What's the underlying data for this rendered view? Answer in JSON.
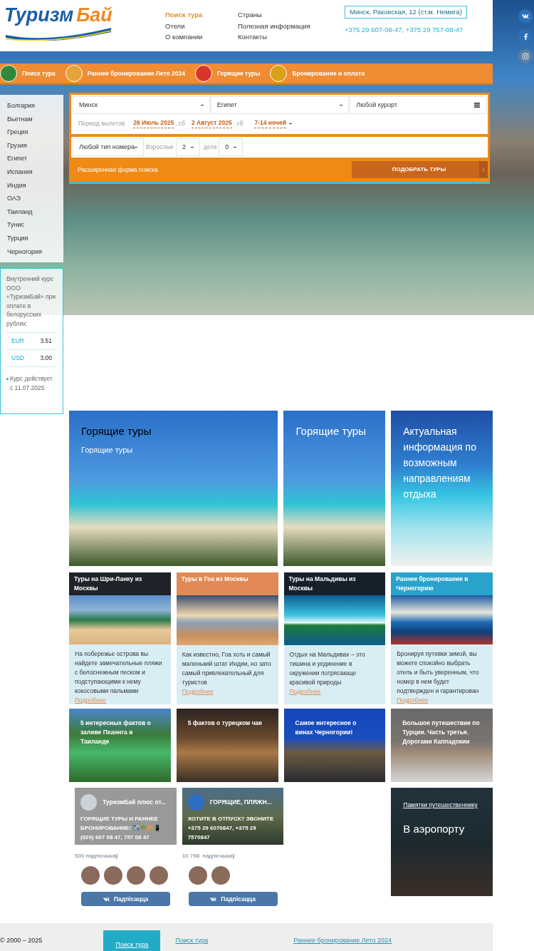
{
  "header": {
    "logo": {
      "first": "Туризм",
      "second": "Бай"
    },
    "nav_columns": [
      [
        {
          "label": "Поиск тура",
          "selected": true
        },
        {
          "label": "Отели",
          "selected": false
        },
        {
          "label": "О компании",
          "selected": false
        }
      ],
      [
        {
          "label": "Страны",
          "selected": false
        },
        {
          "label": "Полезная информация",
          "selected": false
        },
        {
          "label": "Контакты",
          "selected": false
        }
      ]
    ],
    "address": "Минск, Раковская, 12 (ст.м. Немига)",
    "phones": "+375 29 607-08-47, +375 29 757-08-47"
  },
  "social": [
    {
      "kind": "vk"
    },
    {
      "kind": "facebook"
    },
    {
      "kind": "instagram"
    }
  ],
  "nav_bar": [
    {
      "label": "Поиск тура",
      "color": "#2f8a3c"
    },
    {
      "label": "Раннее бронирование Лето 2024",
      "color": "#e7a23a"
    },
    {
      "label": "Горящие туры",
      "color": "#d8362a"
    },
    {
      "label": "Бронирование и оплата",
      "color": "#d9a21a"
    }
  ],
  "countries": [
    "Болгария",
    "Вьетнам",
    "Греция",
    "Грузия",
    "Египет",
    "Испания",
    "Индия",
    "ОАЭ",
    "Таиланд",
    "Тунис",
    "Турция",
    "Черногория"
  ],
  "search": {
    "departure": "Минск",
    "destination": "Египет",
    "resort": "Любой курорт",
    "period_label": "Период вылетов",
    "date_from": "26 Июль 2025",
    "day_from": ", сб",
    "date_to": "2 Август 2025",
    "day_to": ", сб",
    "nights": "7-14 ночей",
    "room": "Любой тип номера",
    "adults_label": "Взрослые",
    "adults": "2",
    "children_label": "дети",
    "children": "0",
    "extended_link": "Расширенная форма поиска",
    "submit": "ПОДОБРАТЬ ТУРЫ"
  },
  "rates": {
    "intro": "Внутренний курс ООО «ТуризмБай» при оплате в белорусских рублях:",
    "rows": [
      {
        "currency": "EUR",
        "value": "3.51"
      },
      {
        "currency": "USD",
        "value": "3.00"
      }
    ],
    "note": "Курс действует с 11.07.2025"
  },
  "feature_cards": [
    {
      "kind": "wide",
      "title": "Горящие туры",
      "subtitle": "Горящие туры"
    },
    {
      "kind": "narrow",
      "title": "Горящие туры"
    },
    {
      "kind": "info",
      "title": "Актуальная информация по возможным направлениям отдыха"
    }
  ],
  "tour_cards": [
    {
      "title": "Туры на Шри-Ланку из Москвы",
      "color": "#1d2329",
      "text": "На побережье острова вы найдете замечательные пляжи с белоснежным песком и подступающими к нему кокосовыми пальмами",
      "link": "Подробнее"
    },
    {
      "title": "Туры в Гоа из Москвы",
      "color": "#e28a55",
      "text": "Как известно, Гоа хоть и самый маленький штат Индии, но зато самый привлекательный для туристов",
      "link": "Подробнее"
    },
    {
      "title": "Туры на Мальдивы из Москвы",
      "color": "#15202b",
      "text": "Отдых на Мальдивах – это тишина и уединение в окружении потрясающе красивой природы",
      "link": "Подробнее"
    },
    {
      "title": "Раннее бронирование в Черногорию",
      "color": "#29a3cc",
      "text": "Бронируя путевки зимой, вы можете спокойно выбрать отель и быть уверенным, что номер в нем будет подтвержден и гарантирован",
      "link": "Подробнее"
    }
  ],
  "articles": [
    "5 интересных фактов о заливе Пханнга в Таиланде",
    "5 фактов о турецком чае",
    "Самое интересное о винах Черногории!",
    "Большое путешествие по Турции. Часть третья. Дорогами Каппадокии"
  ],
  "vk_widgets": [
    {
      "kind": "plain",
      "name": "ТуризмБай плюс от...",
      "post": "ГОРЯЩИЕ ТУРЫ И РАННЕЕ БРОНИРОВАНИЕ! ✈️🌴🔆📱 (029) 607 08 47, 757 08 47",
      "subscribers": "500 падпісчыкаў",
      "members": [
        {
          "kind": "photo"
        },
        {
          "kind": "photo"
        },
        {
          "kind": "photo"
        },
        {
          "kind": "photo"
        }
      ],
      "button": "Падпісацца"
    },
    {
      "kind": "photo",
      "name": "ГОРЯЩИЕ, ПЛЯЖН...",
      "post": "ХОТИТЕ В ОТПУСК? ЗВОНИТЕ +375 29 6070847, +375 29 7570847",
      "subscribers": "10 798  падпісчыкаў",
      "members": [
        {
          "kind": "photo"
        },
        {
          "kind": "photo"
        }
      ],
      "button": "Падпісацца"
    }
  ],
  "travel_card": {
    "link": "Памятки путешественнику",
    "title": "В аэропорту"
  },
  "footer": {
    "copyright": "© 2000 – 2025",
    "links": [
      {
        "label": "Поиск тура",
        "selected": true
      },
      {
        "label": "Поиск тура",
        "selected": false
      },
      {
        "label": "Раннее бронирование Лето 2024",
        "selected": false
      }
    ]
  }
}
